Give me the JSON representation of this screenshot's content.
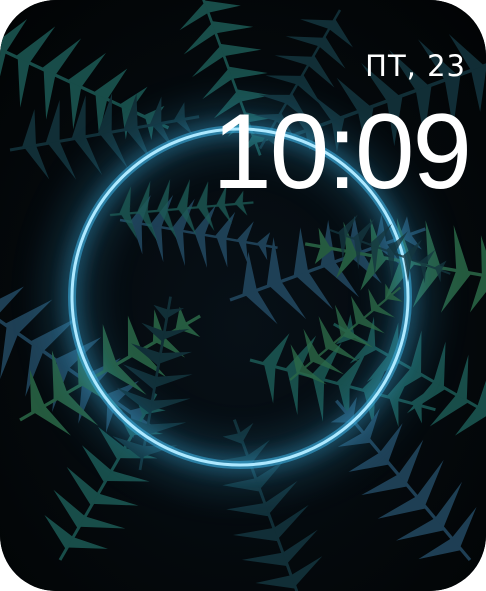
{
  "watch_face": {
    "date_text": "ПТ, 23",
    "time_text": "10:09",
    "ring_color": "#aee9ff",
    "ring_glow_color": "#39a6d6",
    "leaf_colors": [
      "#1d5a55",
      "#244a63",
      "#2c6a48",
      "#15363f"
    ],
    "background_color": "#03070a",
    "wallpaper": "tropical-palm-leaves-with-neon-ring"
  }
}
